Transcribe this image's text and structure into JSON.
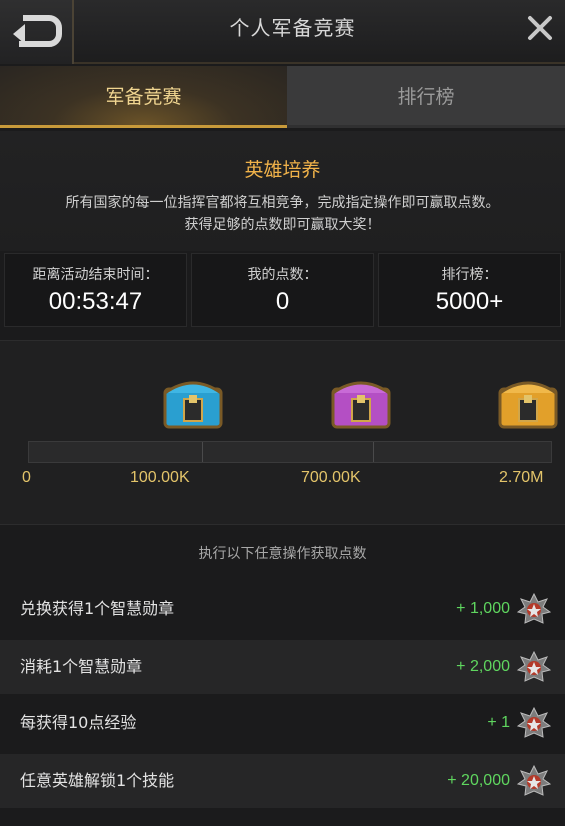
{
  "header": {
    "title": "个人军备竞赛"
  },
  "tabs": [
    {
      "label": "军备竞赛",
      "active": true
    },
    {
      "label": "排行榜",
      "active": false
    }
  ],
  "event": {
    "title": "英雄培养",
    "description_line1": "所有国家的每一位指挥官都将互相竞争，完成指定操作即可赢取点数。",
    "description_line2": "获得足够的点数即可赢取大奖！"
  },
  "stats": {
    "time_label": "距离活动结束时间：",
    "time_value": "00:53:47",
    "points_label": "我的点数：",
    "points_value": "0",
    "rank_label": "排行榜：",
    "rank_value": "5000+"
  },
  "rewards": {
    "milestones": [
      "0",
      "100.00K",
      "700.00K",
      "2.70M"
    ],
    "progress_fraction": 0,
    "chests": [
      {
        "icon": "blue-chest-icon",
        "color": "#2a9fd0"
      },
      {
        "icon": "purple-chest-icon",
        "color": "#b44fc4"
      },
      {
        "icon": "gold-chest-icon",
        "color": "#e2a02a"
      }
    ]
  },
  "actions": {
    "header": "执行以下任意操作获取点数",
    "items": [
      {
        "label": "兑换获得1个智慧勋章",
        "points": "+ 1,000"
      },
      {
        "label": "消耗1个智慧勋章",
        "points": "+ 2,000"
      },
      {
        "label": "每获得10点经验",
        "points": "+ 1"
      },
      {
        "label": "任意英雄解锁1个技能",
        "points": "+ 20,000"
      }
    ]
  },
  "colors": {
    "accent": "#f0b24a",
    "points_green": "#5fd65f",
    "milestone_gold": "#e3c46a"
  }
}
